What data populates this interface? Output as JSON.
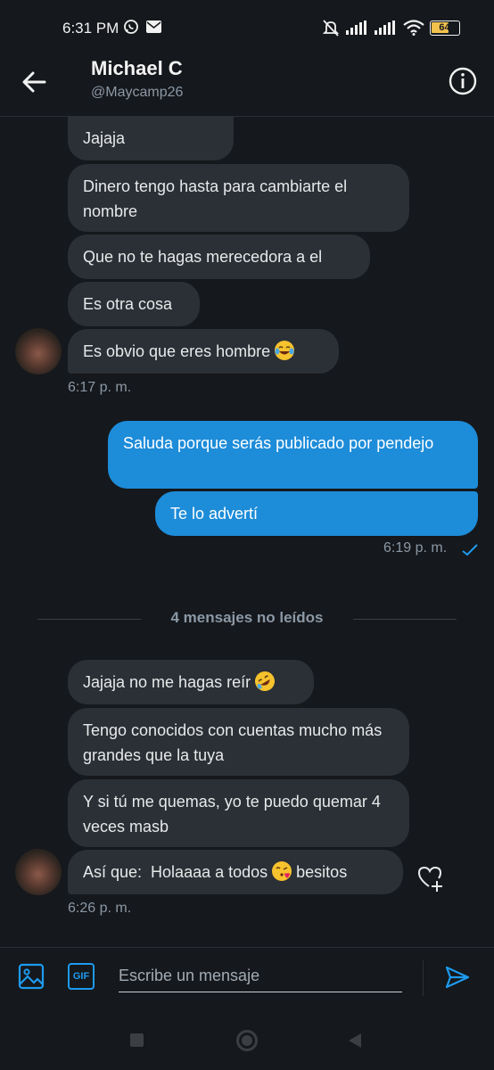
{
  "status_bar": {
    "time": "6:31 PM",
    "battery": "64"
  },
  "header": {
    "name": "Michael C",
    "handle": "@Maycamp26"
  },
  "messages_block1": [
    {
      "text": "Jajaja"
    },
    {
      "text": "Dinero tengo hasta para cambiarte el nombre"
    },
    {
      "text": "Que no te hagas merecedora a el"
    },
    {
      "text": "Es otra cosa"
    },
    {
      "text": "Es obvio que eres hombre",
      "emoji": "face-with-tears-of-joy"
    }
  ],
  "time_block1": "6:17 p. m.",
  "outgoing": [
    {
      "text": "Saluda porque serás publicado por pendejo"
    },
    {
      "text": "Te lo advertí"
    }
  ],
  "time_outgoing": "6:19 p. m.",
  "unread_label": "4 mensajes no leídos",
  "messages_block2": [
    {
      "text": "Jajaja no me hagas reír",
      "emoji": "rolling-on-floor-laughing"
    },
    {
      "text": "Tengo conocidos con cuentas mucho más grandes que la tuya"
    },
    {
      "text": "Y si tú me quemas, yo te puedo quemar 4 veces masb"
    },
    {
      "text_before": "Así que:  Holaaaa a todos ",
      "emoji": "face-blowing-kiss",
      "text_after": " besitos"
    }
  ],
  "time_block2": "6:26 p. m.",
  "composer": {
    "placeholder": "Escribe un mensaje",
    "gif_label": "GIF"
  },
  "colors": {
    "background": "#15181c",
    "incoming_bubble": "#2b3036",
    "outgoing_bubble": "#1d8cd9",
    "accent": "#1d9bf0",
    "muted_text": "#8b98a5"
  }
}
